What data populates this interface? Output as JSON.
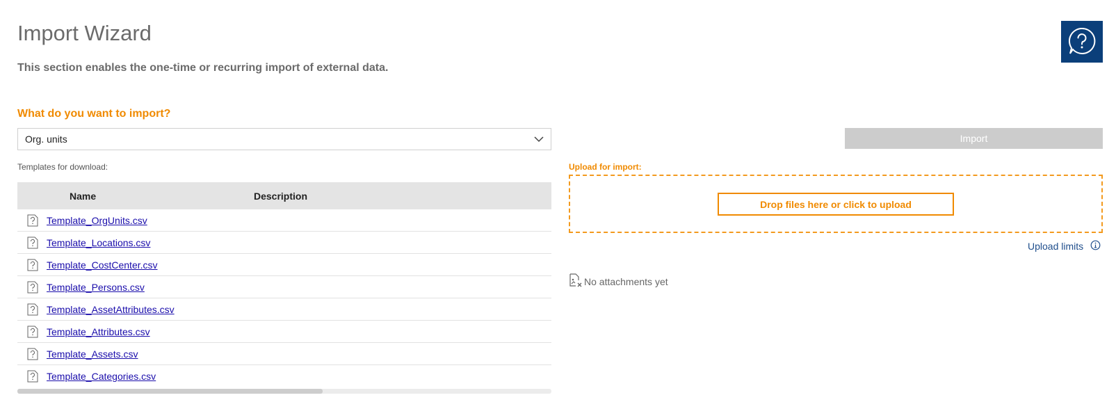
{
  "header": {
    "title": "Import Wizard",
    "subtitle": "This section enables the one-time or recurring import of external data.",
    "help_icon": "help-chat-icon"
  },
  "import_form": {
    "question": "What do you want to import?",
    "selected_type": "Org. units",
    "templates_label": "Templates for download:",
    "table_headers": {
      "name": "Name",
      "description": "Description"
    },
    "templates": [
      {
        "name": "Template_OrgUnits.csv",
        "description": ""
      },
      {
        "name": "Template_Locations.csv",
        "description": ""
      },
      {
        "name": "Template_CostCenter.csv",
        "description": ""
      },
      {
        "name": "Template_Persons.csv",
        "description": ""
      },
      {
        "name": "Template_AssetAttributes.csv",
        "description": ""
      },
      {
        "name": "Template_Attributes.csv",
        "description": ""
      },
      {
        "name": "Template_Assets.csv",
        "description": ""
      },
      {
        "name": "Template_Categories.csv",
        "description": ""
      }
    ]
  },
  "upload": {
    "import_label": "Import",
    "upload_label": "Upload for import:",
    "drop_label": "Drop files here or click to upload",
    "limits_label": "Upload limits",
    "no_attachments": "No attachments yet"
  },
  "colors": {
    "accent": "#f08a00",
    "help_bg": "#0b3f7a",
    "link": "#1a0dab",
    "disabled": "#cccccc"
  }
}
